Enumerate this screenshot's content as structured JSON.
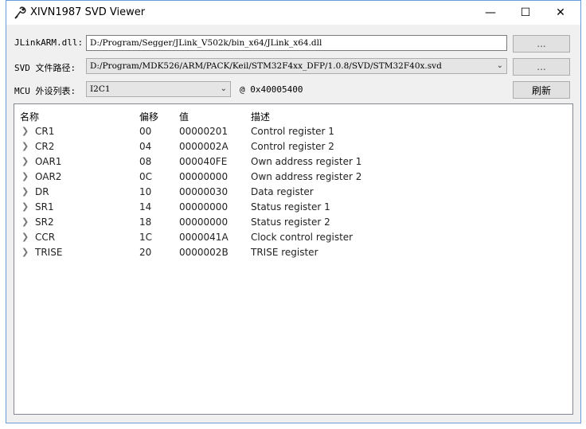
{
  "window": {
    "title": "XIVN1987 SVD Viewer"
  },
  "titlebar": {
    "minimize": "—",
    "maximize": "☐",
    "close": "✕"
  },
  "jlink": {
    "label": "JLinkARM.dll:",
    "value": "D:/Program/Segger/JLink_V502k/bin_x64/JLink_x64.dll",
    "browse": "..."
  },
  "svd": {
    "label": "SVD 文件路径:",
    "value": "D:/Program/MDK526/ARM/PACK/Keil/STM32F4xx_DFP/1.0.8/SVD/STM32F40x.svd",
    "browse": "..."
  },
  "mcu": {
    "label": "MCU 外设列表:",
    "value": "I2C1",
    "address": "@ 0x40005400",
    "refresh": "刷新"
  },
  "table": {
    "headers": [
      "名称",
      "偏移",
      "值",
      "描述"
    ],
    "rows": [
      {
        "name": "CR1",
        "offset": "00",
        "value": "00000201",
        "desc": "Control register 1"
      },
      {
        "name": "CR2",
        "offset": "04",
        "value": "0000002A",
        "desc": "Control register 2"
      },
      {
        "name": "OAR1",
        "offset": "08",
        "value": "000040FE",
        "desc": "Own address register 1"
      },
      {
        "name": "OAR2",
        "offset": "0C",
        "value": "00000000",
        "desc": "Own address register 2"
      },
      {
        "name": "DR",
        "offset": "10",
        "value": "00000030",
        "desc": "Data register"
      },
      {
        "name": "SR1",
        "offset": "14",
        "value": "00000000",
        "desc": "Status register 1"
      },
      {
        "name": "SR2",
        "offset": "18",
        "value": "00000000",
        "desc": "Status register 2"
      },
      {
        "name": "CCR",
        "offset": "1C",
        "value": "0000041A",
        "desc": "Clock control register"
      },
      {
        "name": "TRISE",
        "offset": "20",
        "value": "0000002B",
        "desc": "TRISE register"
      }
    ]
  },
  "icons": {
    "app": "wrench-icon",
    "expander": "chevron-right-icon",
    "dropdown": "chevron-down-icon"
  },
  "colors": {
    "window_border": "#6b9bd8",
    "background": "#f0f0f0"
  }
}
